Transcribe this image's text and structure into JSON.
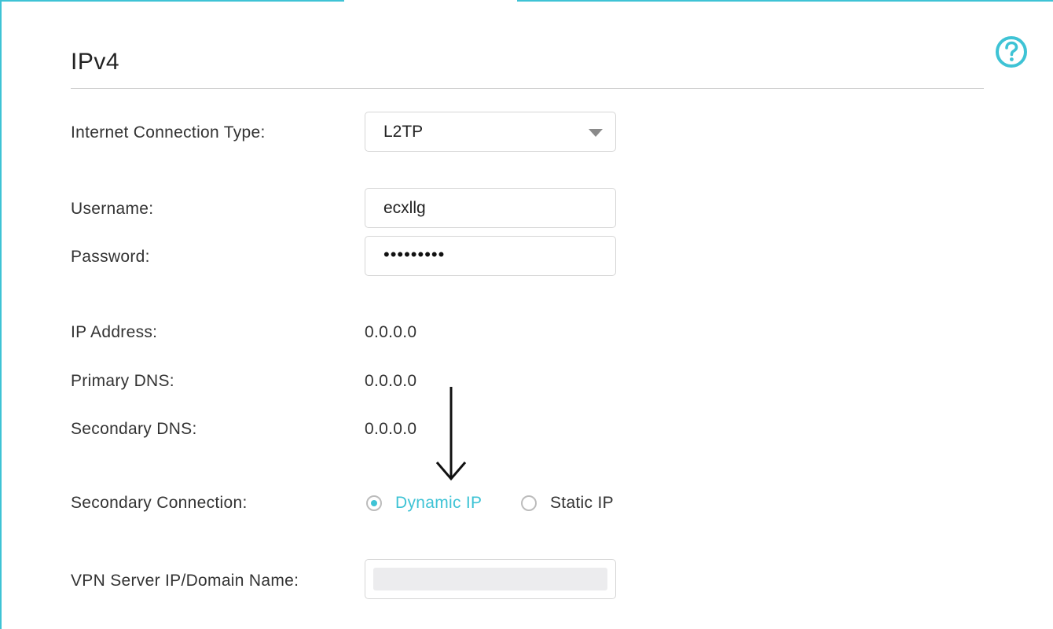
{
  "section": {
    "title": "IPv4",
    "help_icon": "question-circle-icon"
  },
  "fields": {
    "connection_type": {
      "label": "Internet Connection Type:",
      "value": "L2TP"
    },
    "username": {
      "label": "Username:",
      "value": "ecxllg"
    },
    "password": {
      "label": "Password:",
      "masked": "•••••••••"
    },
    "ip_address": {
      "label": "IP Address:",
      "value": "0.0.0.0"
    },
    "primary_dns": {
      "label": "Primary DNS:",
      "value": "0.0.0.0"
    },
    "secondary_dns": {
      "label": "Secondary DNS:",
      "value": "0.0.0.0"
    },
    "secondary_connection": {
      "label": "Secondary Connection:",
      "options": [
        "Dynamic IP",
        "Static IP"
      ],
      "selected": "Dynamic IP"
    },
    "vpn_server": {
      "label": "VPN Server IP/Domain Name:",
      "value": ""
    }
  },
  "colors": {
    "accent": "#3ec3d5",
    "text": "#333333",
    "border": "#d6d6d6"
  },
  "annotation": {
    "icon": "down-arrow-icon"
  }
}
